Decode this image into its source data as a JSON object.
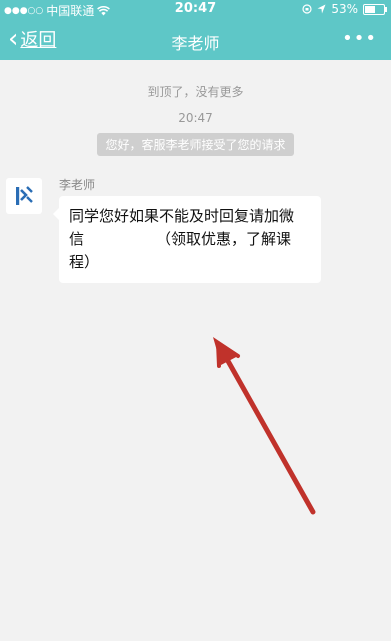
{
  "status_bar": {
    "carrier": "中国联通",
    "time": "20:47",
    "battery_percent_text": "53%",
    "battery_level": 0.53
  },
  "navbar": {
    "back_label": "返回",
    "title": "李老师",
    "more_label": "•••"
  },
  "chat": {
    "top_notice": "到顶了，没有更多",
    "timestamp": "20:47",
    "system_message": "您好，客服李老师接受了您的请求",
    "messages": [
      {
        "sender": "李老师",
        "line1": "同学您好如果不能及时回复请加微",
        "line2_start": "信",
        "line2_end": "（领取优惠，了解课程）"
      }
    ]
  },
  "colors": {
    "header": "#5ec7c7",
    "background": "#f2f2f2",
    "arrow": "#c0322b",
    "avatar_logo": "#2a6db5"
  },
  "icons": [
    "wifi-icon",
    "location-icon",
    "battery-icon",
    "back-chevron-icon",
    "more-icon",
    "avatar-logo-icon",
    "arrow-annotation"
  ]
}
